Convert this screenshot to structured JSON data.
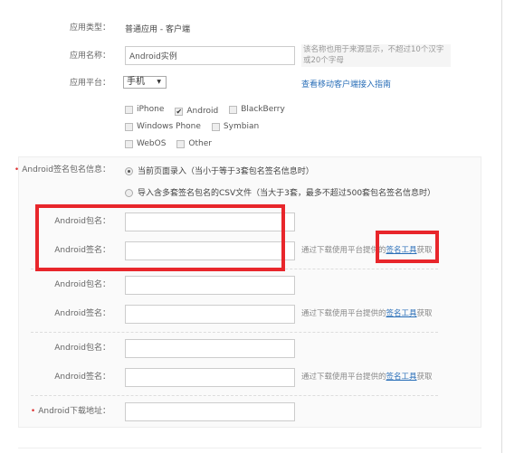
{
  "app_type": {
    "label": "应用类型：",
    "value": "普通应用 - 客户端"
  },
  "app_name": {
    "label": "应用名称：",
    "value": "Android实例",
    "hint": "该名称也用于来源显示，不超过10个汉字或20个字母"
  },
  "platform": {
    "label": "应用平台：",
    "selected": "手机",
    "guide_link": "查看移动客户端接入指南",
    "options": [
      {
        "label": "iPhone",
        "checked": false
      },
      {
        "label": "Android",
        "checked": true
      },
      {
        "label": "BlackBerry",
        "checked": false
      },
      {
        "label": "Windows Phone",
        "checked": false
      },
      {
        "label": "Symbian",
        "checked": false
      },
      {
        "label": "WebOS",
        "checked": false
      },
      {
        "label": "Other",
        "checked": false
      }
    ]
  },
  "sign_info": {
    "label": "Android签名包名信息：",
    "radio1": "当前页面录入（当小于等于3套包名签名信息时）",
    "radio2": "导入含多套签名包名的CSV文件（当大于3套，最多不超过500套包名签名信息时）"
  },
  "pairs": [
    {
      "pkg_label": "Android包名：",
      "sig_label": "Android签名：",
      "hint_pre": "通过下载使用平台提供的",
      "hint_link": "签名工具",
      "hint_post": "获取"
    },
    {
      "pkg_label": "Android包名：",
      "sig_label": "Android签名：",
      "hint_pre": "通过下载使用平台提供的",
      "hint_link": "签名工具",
      "hint_post": "获取"
    },
    {
      "pkg_label": "Android包名：",
      "sig_label": "Android签名：",
      "hint_pre": "通过下载使用平台提供的",
      "hint_link": "签名工具",
      "hint_post": "获取"
    }
  ],
  "download": {
    "label": "Android下载地址："
  },
  "colors": {
    "highlight": "#e8262b",
    "link": "#2a6fb8"
  }
}
